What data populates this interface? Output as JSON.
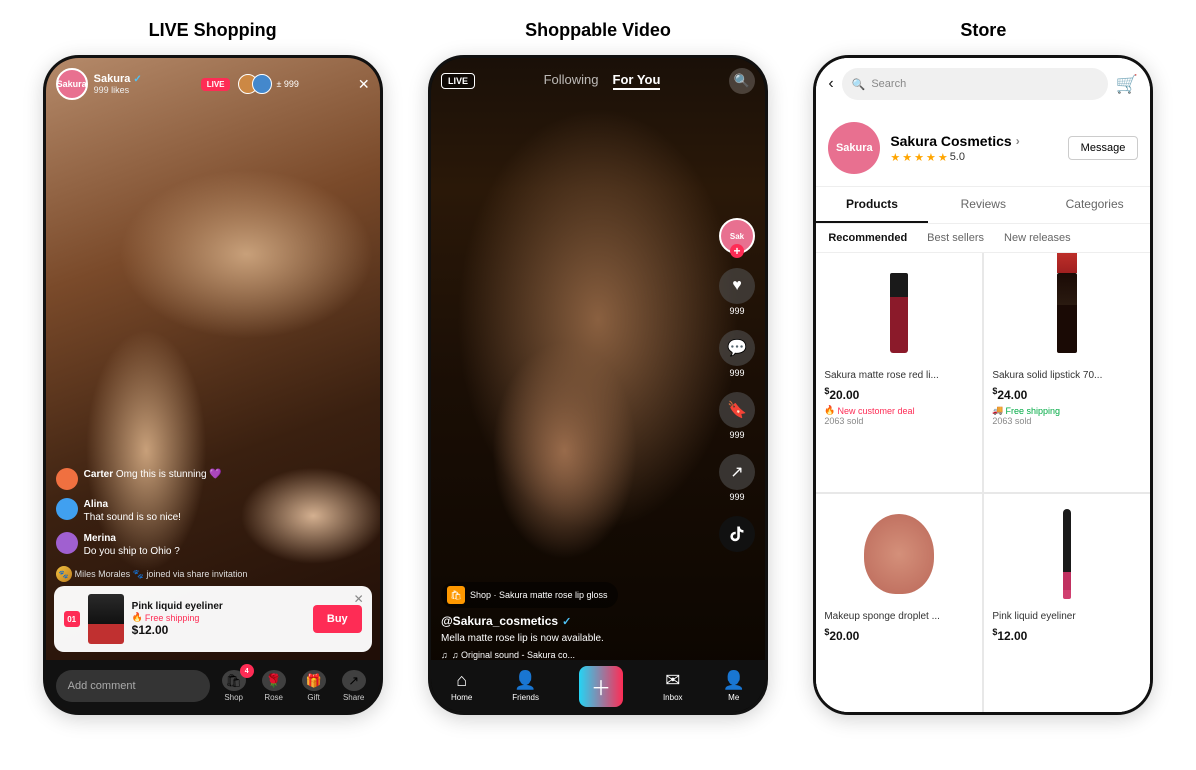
{
  "sections": [
    {
      "id": "live-shopping",
      "title": "LIVE Shopping"
    },
    {
      "id": "shoppable-video",
      "title": "Shoppable Video"
    },
    {
      "id": "store",
      "title": "Store"
    }
  ],
  "live": {
    "username": "Sakura",
    "verified": true,
    "likes": "999 likes",
    "badge": "LIVE",
    "viewer_count": "± 999",
    "product": {
      "num": "01",
      "name": "Pink liquid eyeliner",
      "shipping": "Free shipping",
      "price": "$12.00"
    },
    "comments": [
      {
        "name": "Carter",
        "text": "Omg this is stunning 💜",
        "avatar_class": "c1"
      },
      {
        "name": "Alina",
        "text": "That sound is so nice!",
        "avatar_class": "c2"
      },
      {
        "name": "Merina",
        "text": "Do you ship to Ohio ?",
        "avatar_class": "c3"
      }
    ],
    "join_msg": "Miles Morales 🐾 joined via share invitation",
    "add_comment": "Add comment",
    "bottom_icons": [
      "Shop",
      "Rose",
      "Gift",
      "Share"
    ]
  },
  "shoppable": {
    "following_label": "Following",
    "for_you_label": "For You",
    "live_badge": "LIVE",
    "shop_tag": "Shop · Sakura matte rose lip gloss",
    "creator_handle": "@Sakura_cosmetics",
    "caption": "Mella matte rose lip is now available.",
    "audio": "♫ Original sound - Sakura co...",
    "action_counts": [
      "999",
      "999",
      "999",
      "999"
    ],
    "nav_items": [
      "Home",
      "Friends",
      "",
      "Inbox",
      "Me"
    ]
  },
  "store": {
    "search_placeholder": "Search",
    "store_name": "Sakura Cosmetics",
    "rating": "5.0",
    "message_btn": "Message",
    "tabs": [
      "Products",
      "Reviews",
      "Categories"
    ],
    "active_tab": "Products",
    "subtabs": [
      "Recommended",
      "Best sellers",
      "New releases"
    ],
    "active_subtab": "Recommended",
    "products": [
      {
        "name": "Sakura matte rose red li...",
        "price": "20.00",
        "deal": "New customer deal",
        "sold": "2063 sold",
        "type": "liquid-lipstick"
      },
      {
        "name": "Sakura solid lipstick 70...",
        "price": "24.00",
        "shipping": "Free shipping",
        "sold": "2063 sold",
        "type": "solid-lipstick"
      },
      {
        "name": "Makeup sponge droplet ...",
        "price": "20.00",
        "type": "sponge"
      },
      {
        "name": "Pink liquid eyeliner",
        "price": "12.00",
        "type": "eyeliner"
      }
    ]
  }
}
